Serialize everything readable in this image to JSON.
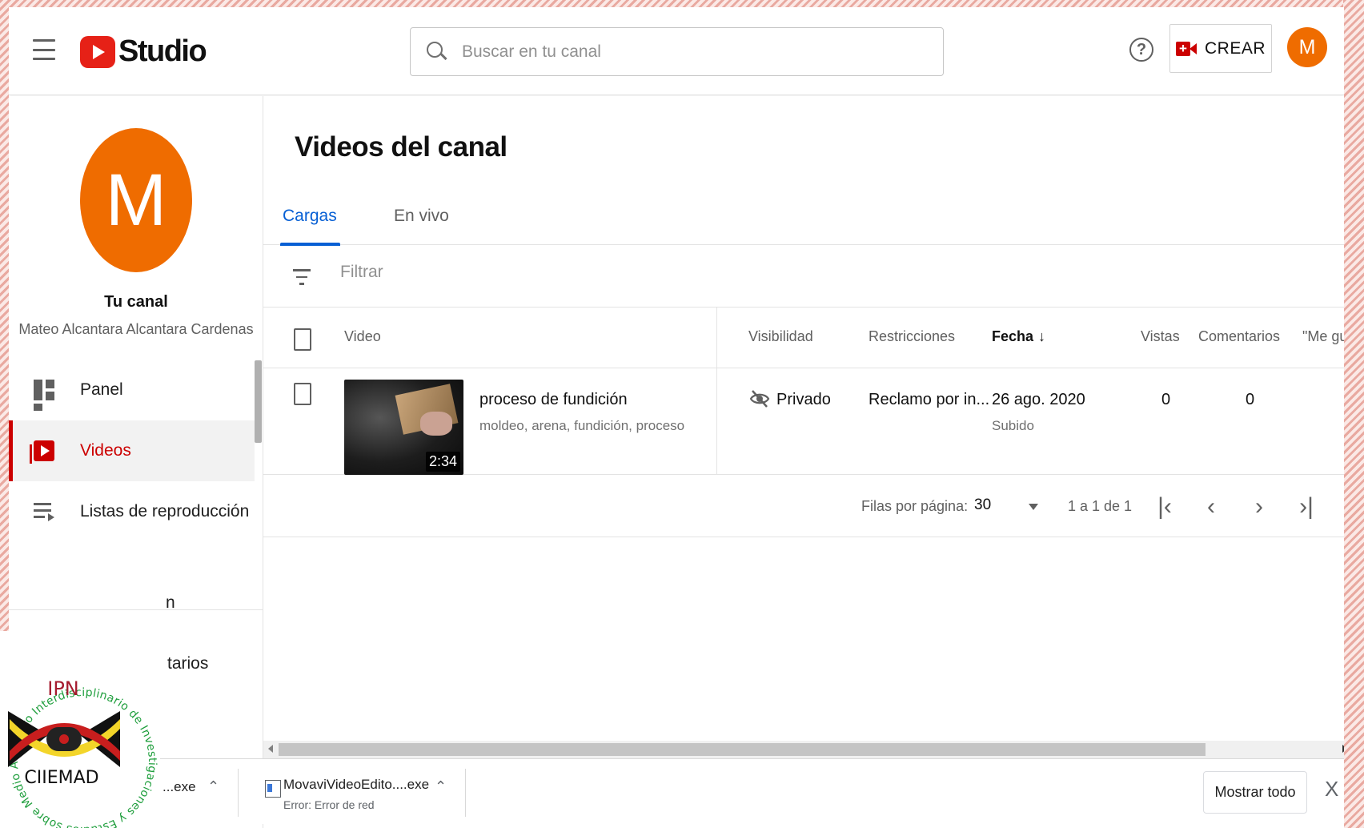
{
  "header": {
    "logo_text": "Studio",
    "search_placeholder": "Buscar en tu canal",
    "help_label": "?",
    "create_label": "CREAR",
    "avatar_initial": "M"
  },
  "sidebar": {
    "avatar_initial": "M",
    "channel_title": "Tu canal",
    "channel_name": "Mateo Alcantara Alcantara Cardenas",
    "items": [
      {
        "label": "Panel",
        "icon": "dashboard-icon"
      },
      {
        "label": "Videos",
        "icon": "videos-icon",
        "active": true
      },
      {
        "label": "Listas de reproducción",
        "icon": "playlists-icon"
      }
    ],
    "partial_items": [
      "n",
      "tarios"
    ]
  },
  "main": {
    "title": "Videos del canal",
    "tabs": [
      {
        "label": "Cargas",
        "active": true
      },
      {
        "label": "En vivo",
        "active": false
      }
    ],
    "filter_placeholder": "Filtrar",
    "columns": [
      "Video",
      "Visibilidad",
      "Restricciones",
      "Fecha",
      "Vistas",
      "Comentarios",
      "\"Me gust"
    ],
    "sorted_column": "Fecha",
    "rows": [
      {
        "title": "proceso de fundición",
        "description": "moldeo, arena, fundición, proceso",
        "duration": "2:34",
        "visibility": "Privado",
        "restrictions": "Reclamo por in...",
        "date": "26 ago. 2020",
        "date_status": "Subido",
        "views": "0",
        "comments": "0"
      }
    ],
    "pagination": {
      "rows_per_page_label": "Filas por página:",
      "rows_per_page_value": "30",
      "range": "1 a 1 de 1"
    }
  },
  "downloads": {
    "items": [
      {
        "name": "...exe",
        "status": ""
      },
      {
        "name": "MovaviVideoEdito....exe",
        "status": "Error: Error de red"
      }
    ],
    "show_all_label": "Mostrar todo",
    "close_label": "X"
  },
  "seal": {
    "top_text": "IPN",
    "bottom_text": "CIIEMAD",
    "ring_text": "Centro Interdisciplinario de Investigaciones y Estudios sobre Medio Ambiente y Desarrollo"
  },
  "colors": {
    "accent_red": "#cc0000",
    "avatar_orange": "#ef6c00",
    "tab_blue": "#065fd4"
  }
}
